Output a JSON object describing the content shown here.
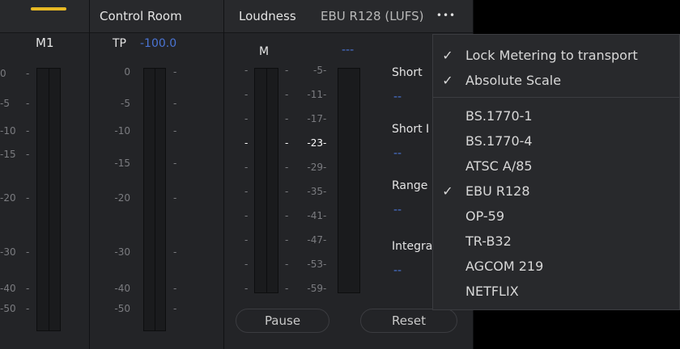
{
  "track": {
    "name": "M1",
    "accent": "#e8b924"
  },
  "control_room": {
    "title": "Control Room",
    "tp_label": "TP",
    "tp_value": "-100.0"
  },
  "scale_left": [
    "0",
    "-5",
    "-10",
    "-15",
    "-20",
    "-30",
    "-40",
    "-50"
  ],
  "scale_cr": [
    "0",
    "-5",
    "-10",
    "-15",
    "-20",
    "-30",
    "-40",
    "-50"
  ],
  "loudness": {
    "title": "Loudness",
    "standard": "EBU R128 (LUFS)",
    "menu_dots": "•••",
    "m_label": "M",
    "m_value": "---",
    "scale": [
      "-5",
      "-11",
      "-17",
      "-23",
      "-29",
      "-35",
      "-41",
      "-47",
      "-53",
      "-59"
    ],
    "readouts": [
      {
        "label": "Short",
        "value": "--"
      },
      {
        "label": "Short I",
        "value": "--"
      },
      {
        "label": "Range",
        "value": "--"
      },
      {
        "label": "Integra",
        "value": "--"
      }
    ],
    "pause_label": "Pause",
    "reset_label": "Reset"
  },
  "menu": {
    "options": [
      {
        "label": "Lock Metering to transport",
        "checked": true
      },
      {
        "label": "Absolute Scale",
        "checked": true
      }
    ],
    "standards": [
      {
        "label": "BS.1770-1",
        "checked": false
      },
      {
        "label": "BS.1770-4",
        "checked": false
      },
      {
        "label": "ATSC A/85",
        "checked": false
      },
      {
        "label": "EBU R128",
        "checked": true
      },
      {
        "label": "OP-59",
        "checked": false
      },
      {
        "label": "TR-B32",
        "checked": false
      },
      {
        "label": "AGCOM 219",
        "checked": false
      },
      {
        "label": "NETFLIX",
        "checked": false
      }
    ],
    "check_glyph": "✓"
  },
  "colors": {
    "value_blue": "#4a74d4",
    "accent_yellow": "#e8b924"
  }
}
